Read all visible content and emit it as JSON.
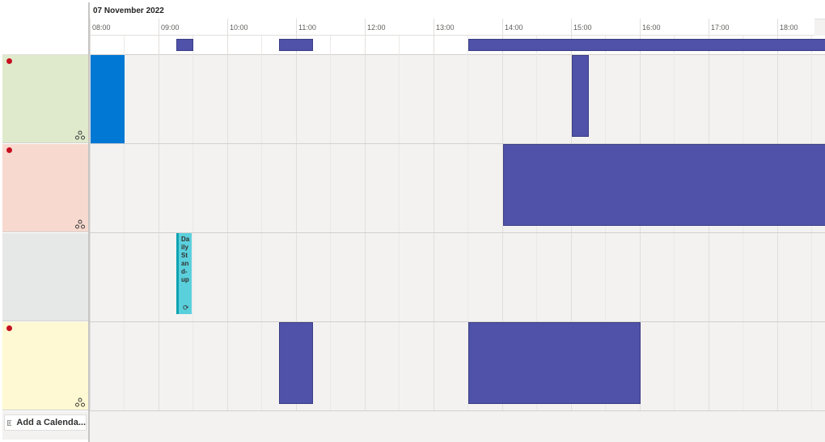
{
  "date_header": "07 November 2022",
  "hours": [
    "08:00",
    "09:00",
    "10:00",
    "11:00",
    "12:00",
    "13:00",
    "14:00",
    "15:00",
    "16:00",
    "17:00",
    "18:00"
  ],
  "calendars": [
    {
      "color": "#dfeacc",
      "has_alert_dot": true,
      "shared_icon": "share-icon"
    },
    {
      "color": "#f7d9cf",
      "has_alert_dot": true,
      "shared_icon": "share-icon"
    },
    {
      "color": "#e6e8e7",
      "has_alert_dot": false,
      "shared_icon": ""
    },
    {
      "color": "#fef9d2",
      "has_alert_dot": true,
      "shared_icon": "share-icon"
    }
  ],
  "events": {
    "daily_standup": {
      "title": "Daily Stand-up",
      "icon": "recurring-icon"
    }
  },
  "add_calendar": {
    "label": "Add a Calenda...",
    "icon": "calendar-person-icon"
  },
  "colors": {
    "busy": "#4f52a8",
    "selected_busy": "#0078d4",
    "standup": "#5ad0dc",
    "alert_dot": "#c50f1f"
  }
}
